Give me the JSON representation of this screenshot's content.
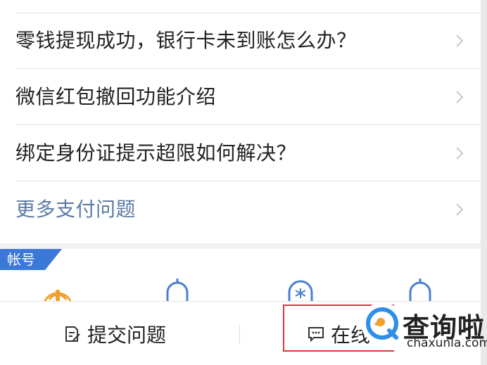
{
  "faq": {
    "items": [
      {
        "label": "零钱提现成功，银行卡未到账怎么办？"
      },
      {
        "label": "微信红包撤回功能介绍"
      },
      {
        "label": "绑定身份证提示超限如何解决？"
      }
    ],
    "more_label": "更多支付问题"
  },
  "section": {
    "tag": "帐号",
    "icons": [
      "phone-signal-icon",
      "bell-icon",
      "bell-snowflake-icon",
      "bell-icon"
    ]
  },
  "bottom_bar": {
    "submit_label": "提交问题",
    "online_label_partial": "在线",
    "submit_icon": "edit-note-icon",
    "online_icon": "chat-bubble-icon"
  },
  "watermark": {
    "title": "查询啦",
    "subtitle": "chaxunla.com"
  },
  "colors": {
    "link": "#5c7aa6",
    "tag_bg": "#3b78d8",
    "icon_orange": "#f0a030",
    "icon_blue": "#4a7fd0",
    "watermark_blue": "#2f8fe8",
    "highlight": "#d9363e"
  }
}
